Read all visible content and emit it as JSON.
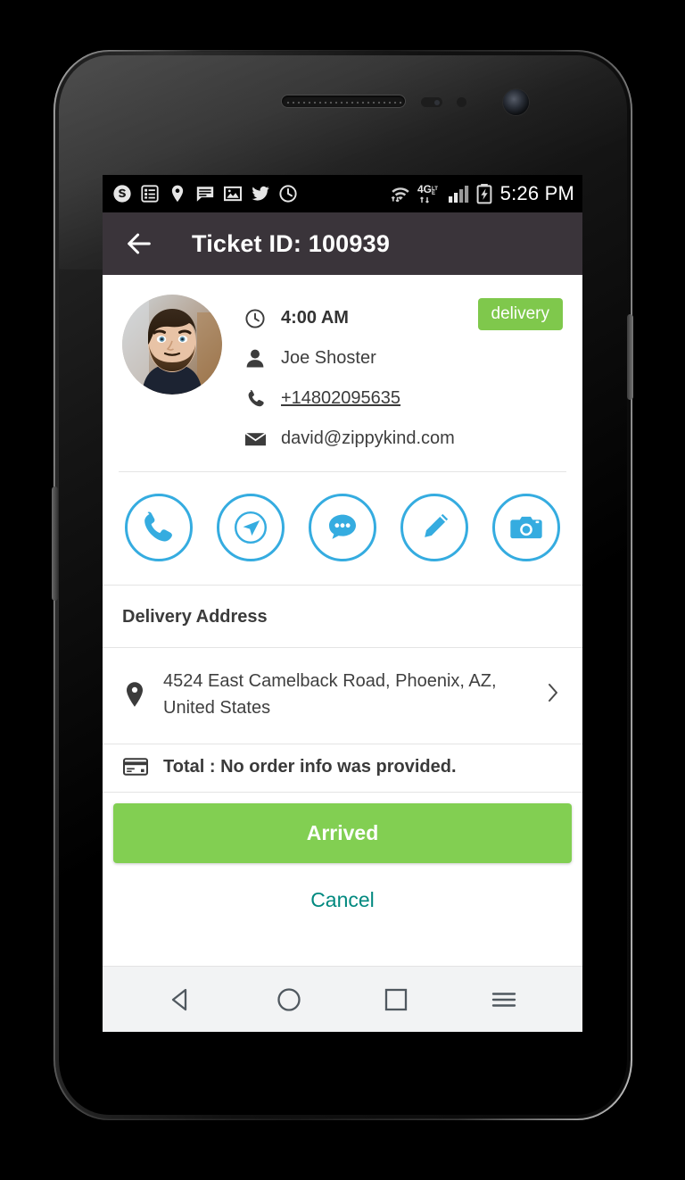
{
  "status_bar": {
    "time": "5:26 PM",
    "network_label": "4G",
    "left_icons": [
      "skype-icon",
      "tasks-list-icon",
      "location-pin-icon",
      "message-icon",
      "image-icon",
      "twitter-icon",
      "clock-icon"
    ],
    "right_icons": [
      "wifi-icon",
      "lte-4g-icon",
      "signal-bars-icon",
      "battery-charging-icon"
    ]
  },
  "appbar": {
    "title": "Ticket ID: 100939",
    "back_icon": "back-arrow-icon"
  },
  "contact": {
    "time": "4:00 AM",
    "name": "Joe Shoster",
    "phone": "+14802095635",
    "email": "david@zippykind.com",
    "badge": "delivery",
    "avatar_alt": "customer-photo"
  },
  "actions": [
    {
      "name": "call-action",
      "icon": "phone-icon"
    },
    {
      "name": "navigate-action",
      "icon": "navigation-arrow-icon"
    },
    {
      "name": "message-action",
      "icon": "chat-bubble-icon"
    },
    {
      "name": "edit-action",
      "icon": "pencil-icon"
    },
    {
      "name": "camera-action",
      "icon": "camera-icon"
    }
  ],
  "delivery": {
    "section_title": "Delivery Address",
    "address": "4524 East Camelback Road, Phoenix, AZ, United States",
    "chevron_icon": "chevron-right-icon",
    "pin_icon": "map-pin-icon"
  },
  "total": {
    "text": "Total : No order info was provided.",
    "icon": "credit-card-icon"
  },
  "footer": {
    "primary_label": "Arrived",
    "secondary_label": "Cancel"
  },
  "navbar": {
    "back": "nav-back-icon",
    "home": "nav-home-icon",
    "recents": "nav-recents-icon",
    "menu": "nav-menu-icon"
  },
  "colors": {
    "accent_blue": "#35ace0",
    "green": "#82cf52",
    "badge_green": "#7fc84c",
    "teal": "#01897f",
    "appbar": "#3a343a"
  }
}
